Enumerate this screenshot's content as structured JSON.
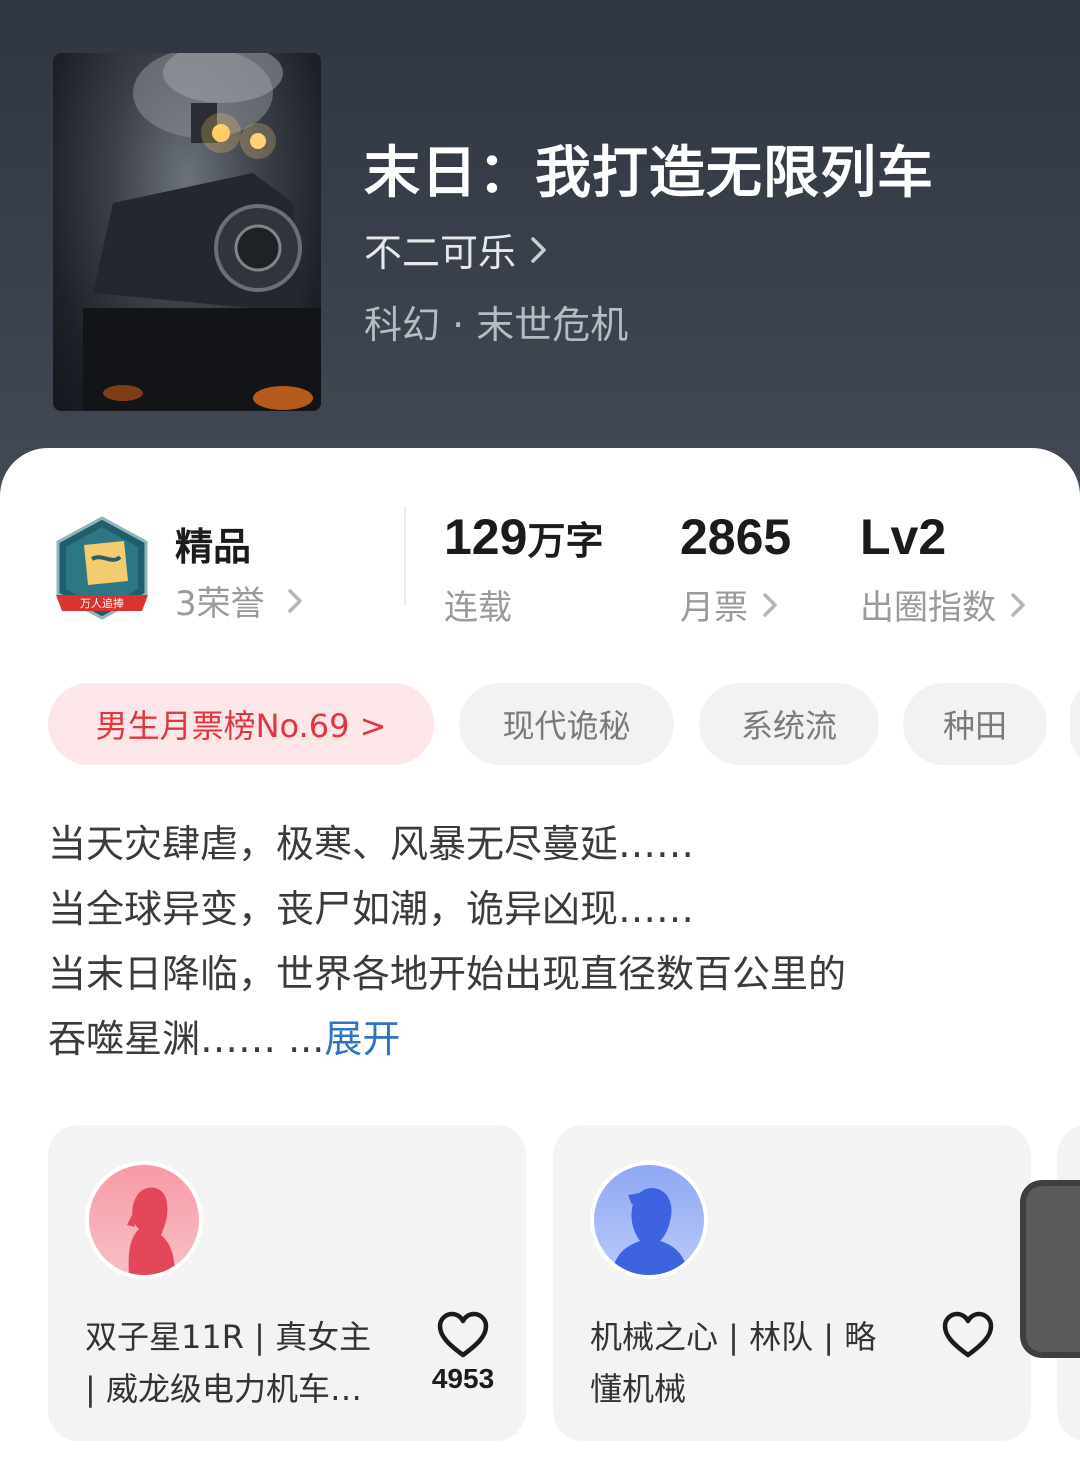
{
  "book": {
    "title": "末日：我打造无限列车",
    "author": "不二可乐",
    "genre": "科幻 · 末世危机"
  },
  "colors": {
    "header_bg": "#353c46",
    "rank_tag_bg": "#fde6e7",
    "rank_tag_text": "#e0363f",
    "link": "#2f73c8"
  },
  "quality": {
    "badge_text": "万人追捧",
    "title": "精品",
    "honor": "3荣誉"
  },
  "stats": {
    "words_value": "129",
    "words_unit": "万字",
    "words_label": "连载",
    "votes_value": "2865",
    "votes_label": "月票",
    "index_value": "Lv2",
    "index_label": "出圈指数"
  },
  "tags": [
    {
      "label": "男生月票榜No.69 >"
    },
    {
      "label": "现代诡秘"
    },
    {
      "label": "系统流"
    },
    {
      "label": "种田"
    }
  ],
  "description": {
    "lines": [
      "当天灾肆虐，极寒、风暴无尽蔓延……",
      "当全球异变，丧尸如潮，诡异凶现……",
      "当末日降临，世界各地开始出现直径数百公里的",
      "吞噬星渊……"
    ],
    "ellipsis": " ...",
    "expand_label": "展开"
  },
  "cards": [
    {
      "avatar_icon": "female-silhouette-icon",
      "line1": "双子星11R | 真女主",
      "line2": "| 威龙级电力机车…",
      "likes": "4953"
    },
    {
      "avatar_icon": "male-silhouette-icon",
      "line1": "机械之心 | 林队 | 略",
      "line2": "懂机械",
      "likes": ""
    }
  ]
}
